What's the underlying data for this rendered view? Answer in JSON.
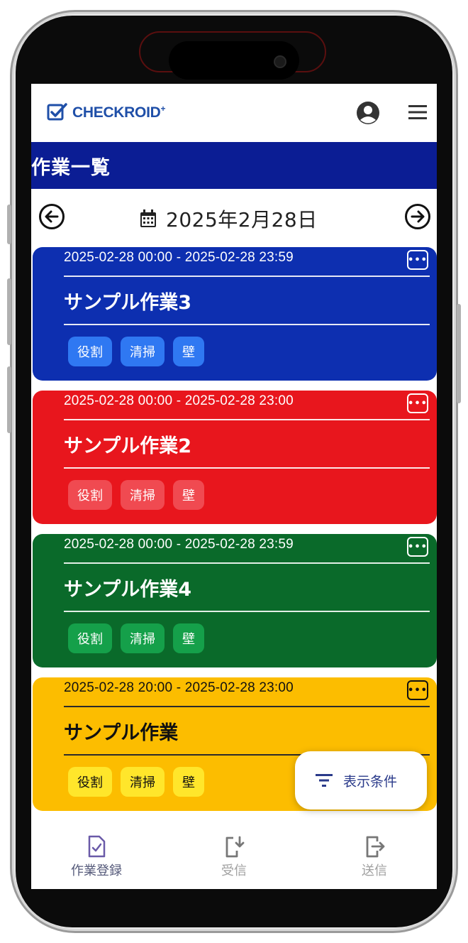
{
  "app": {
    "logo_text": "CHECKROID",
    "logo_suffix": "+"
  },
  "page": {
    "title": "作業一覧"
  },
  "date_nav": {
    "date": "2025年2月28日"
  },
  "tasks": [
    {
      "time": "2025-02-28 00:00 - 2025-02-28 23:59",
      "name": "サンプル作業3",
      "color": "#0d2fb0",
      "tags": [
        "役割",
        "清掃",
        "壁"
      ]
    },
    {
      "time": "2025-02-28 00:00 - 2025-02-28 23:00",
      "name": "サンプル作業2",
      "color": "#e8161d",
      "tags": [
        "役割",
        "清掃",
        "壁"
      ]
    },
    {
      "time": "2025-02-28 00:00 - 2025-02-28 23:59",
      "name": "サンプル作業4",
      "color": "#0a6a2a",
      "tags": [
        "役割",
        "清掃",
        "壁"
      ]
    },
    {
      "time": "2025-02-28 20:00 - 2025-02-28 23:00",
      "name": "サンプル作業",
      "color": "#fcbd00",
      "tags": [
        "役割",
        "清掃",
        "壁"
      ]
    }
  ],
  "filter": {
    "label": "表示条件"
  },
  "bottom_nav": {
    "items": [
      {
        "label": "作業登録",
        "icon": "task-check-icon",
        "state": "active"
      },
      {
        "label": "受信",
        "icon": "receive-icon",
        "state": "disabled"
      },
      {
        "label": "送信",
        "icon": "send-icon",
        "state": "disabled"
      }
    ]
  },
  "colors": {
    "header_bar": "#0b1d94",
    "brand": "#1f4fa8"
  }
}
